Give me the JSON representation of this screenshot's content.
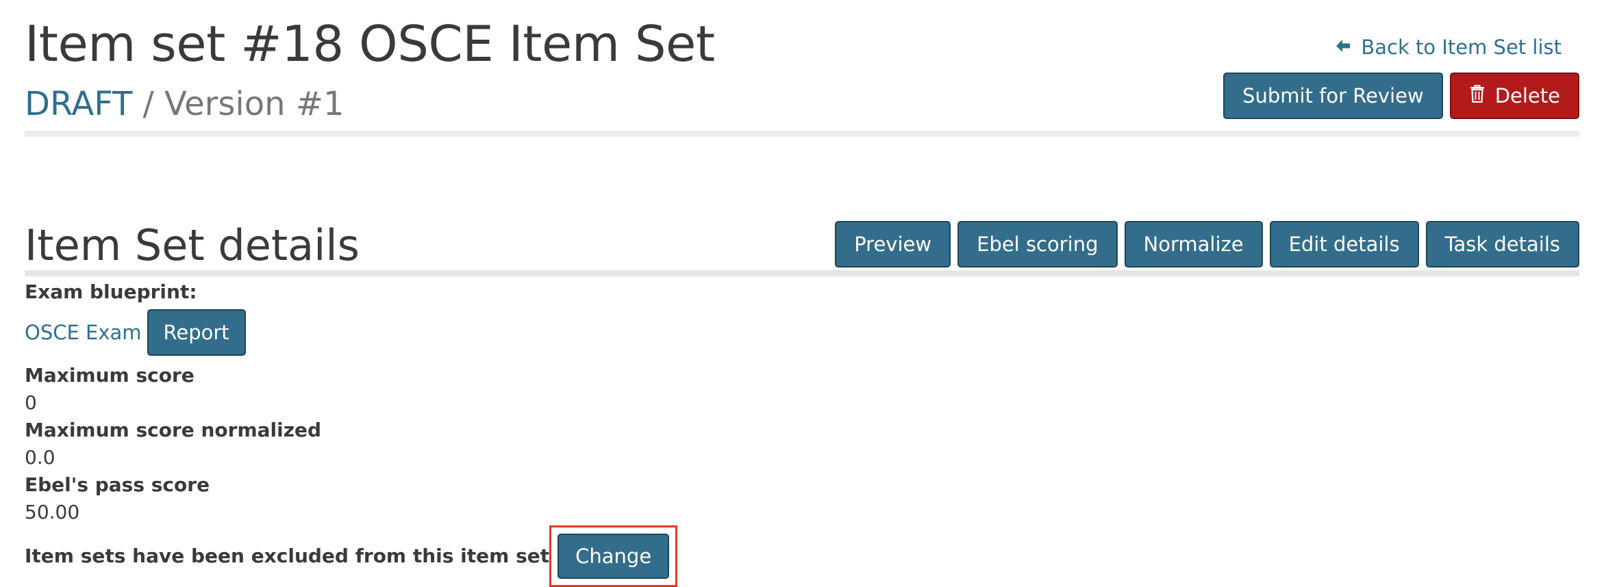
{
  "header": {
    "title": "Item set #18 OSCE Item Set",
    "status": "DRAFT",
    "version": " / Version #1",
    "back_link": "Back to Item Set list",
    "submit_label": "Submit for Review",
    "delete_label": "Delete"
  },
  "details": {
    "title": "Item Set details",
    "actions": {
      "preview": "Preview",
      "ebel_scoring": "Ebel scoring",
      "normalize": "Normalize",
      "edit_details": "Edit details",
      "task_details": "Task details"
    },
    "blueprint": {
      "label": "Exam blueprint:",
      "value": "OSCE Exam",
      "report_label": "Report"
    },
    "max_score": {
      "label": "Maximum score",
      "value": "0"
    },
    "max_score_normalized": {
      "label": "Maximum score normalized",
      "value": "0.0"
    },
    "ebel_pass_score": {
      "label": "Ebel's pass score",
      "value": "50.00"
    },
    "excluded": {
      "label": "Item sets have been excluded from this item set",
      "change_label": "Change"
    }
  },
  "colors": {
    "primary": "#336d8c",
    "danger": "#b31b1b",
    "link": "#2f6f90",
    "highlight": "#e03a2a"
  },
  "icons": {
    "back": "arrow-left-icon",
    "delete": "trash-icon"
  }
}
